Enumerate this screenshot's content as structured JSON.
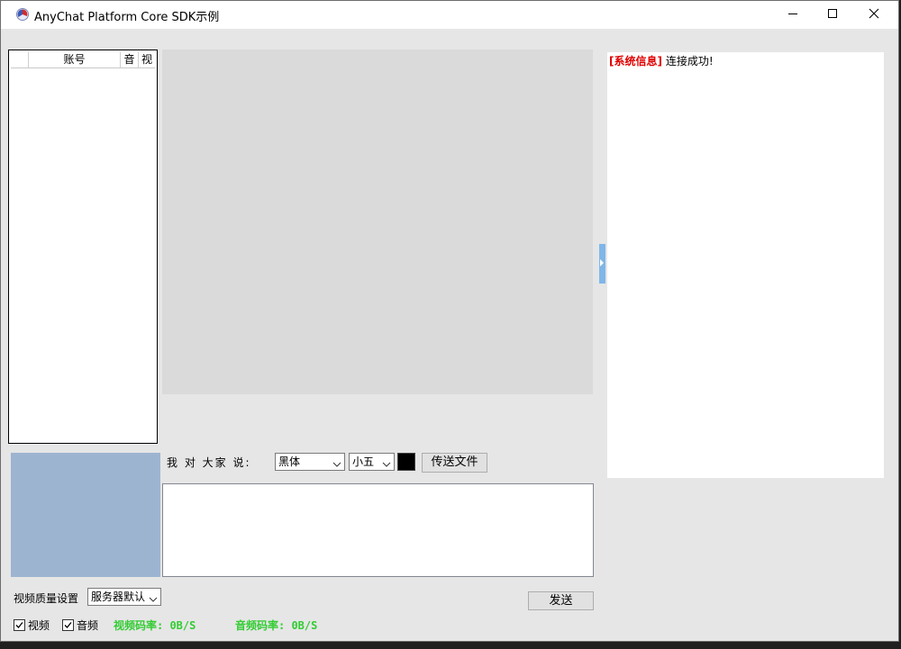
{
  "window": {
    "title": "AnyChat Platform Core SDK示例",
    "controls": {
      "minimize": "minimize-icon",
      "maximize": "maximize-icon",
      "close": "close-icon"
    }
  },
  "user_list": {
    "columns": [
      "",
      "账号",
      "音",
      "视"
    ]
  },
  "chat": {
    "speak_label": "我 对 大家 说:",
    "font_select": "黑体",
    "size_select": "小五",
    "text_color": "#000000",
    "send_file_label": "传送文件",
    "send_label": "发送",
    "input_value": ""
  },
  "messages": [
    {
      "tag": "[系统信息]",
      "text": "连接成功!"
    }
  ],
  "video": {
    "quality_label": "视频质量设置",
    "quality_value": "服务器默认",
    "video_checkbox": {
      "label": "视频",
      "checked": true
    },
    "audio_checkbox": {
      "label": "音频",
      "checked": true
    },
    "video_rate": "视频码率: 0B/S",
    "audio_rate": "音频码率: 0B/S"
  },
  "colors": {
    "system_tag": "#e00000",
    "rate_text": "#33cc33",
    "local_video_bg": "#9db4d1",
    "main_video_bg": "#dadada",
    "splitter": "#7fb6e8"
  }
}
